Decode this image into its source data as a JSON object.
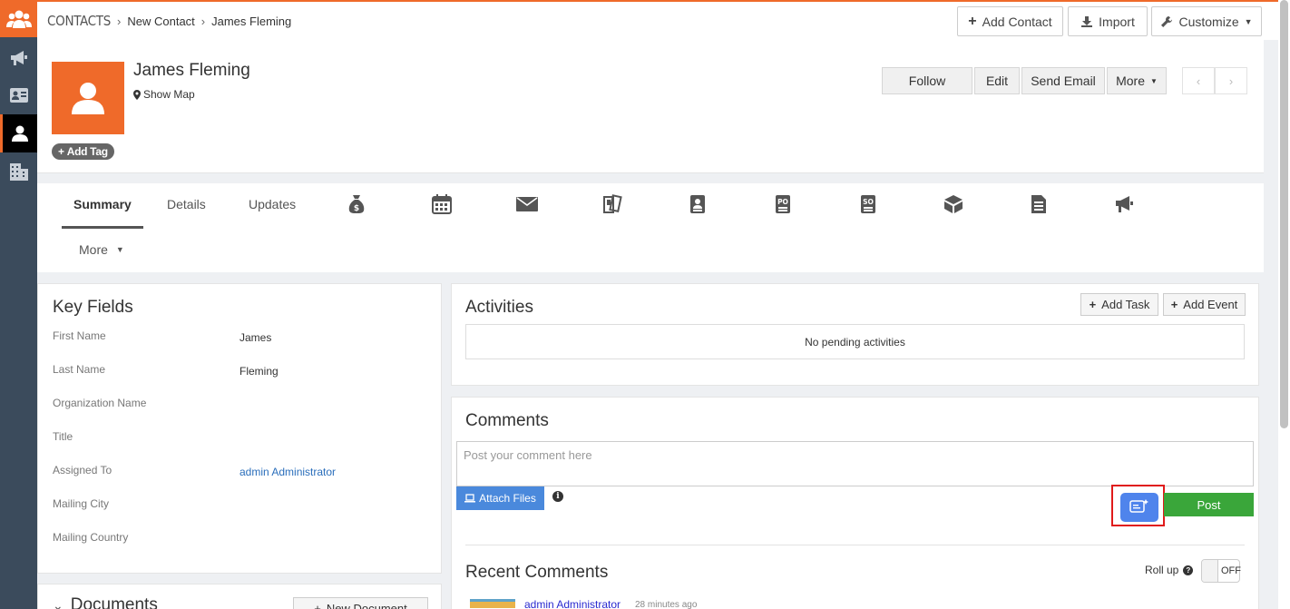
{
  "breadcrumb": {
    "module": "CONTACTS",
    "parent": "New Contact",
    "current": "James Fleming"
  },
  "topbar": {
    "add_contact": "Add Contact",
    "import": "Import",
    "customize": "Customize"
  },
  "record": {
    "name": "James Fleming",
    "show_map": "Show Map",
    "add_tag": "Add Tag"
  },
  "actions": {
    "follow": "Follow",
    "edit": "Edit",
    "send_email": "Send Email",
    "more": "More"
  },
  "tabs": {
    "summary": "Summary",
    "details": "Details",
    "updates": "Updates",
    "more": "More",
    "icons": [
      "money-bag-icon",
      "calendar-icon",
      "envelope-icon",
      "tickets-icon",
      "contact-card-icon",
      "purchase-order-icon",
      "sales-order-icon",
      "box-icon",
      "document-icon",
      "megaphone-icon"
    ]
  },
  "key_fields": {
    "title": "Key Fields",
    "fields": [
      {
        "label": "First Name",
        "value": "James"
      },
      {
        "label": "Last Name",
        "value": "Fleming"
      },
      {
        "label": "Organization Name",
        "value": ""
      },
      {
        "label": "Title",
        "value": ""
      },
      {
        "label": "Assigned To",
        "value": "admin Administrator"
      },
      {
        "label": "Mailing City",
        "value": ""
      },
      {
        "label": "Mailing Country",
        "value": ""
      }
    ]
  },
  "documents": {
    "title": "Documents",
    "new_document": "New Document"
  },
  "activities": {
    "title": "Activities",
    "add_task": "Add Task",
    "add_event": "Add Event",
    "empty": "No pending activities"
  },
  "comments": {
    "title": "Comments",
    "placeholder": "Post your comment here",
    "attach_files": "Attach Files",
    "post": "Post",
    "recent_title": "Recent Comments",
    "roll_up": "Roll up",
    "toggle_state": "OFF",
    "latest_author": "admin Administrator",
    "latest_time": "28 minutes ago"
  },
  "colors": {
    "accent": "#ef6a2a",
    "rail": "#3b4b5c",
    "post": "#3aa63a",
    "attach": "#4a89dc",
    "highlight": "#e01b1b"
  }
}
